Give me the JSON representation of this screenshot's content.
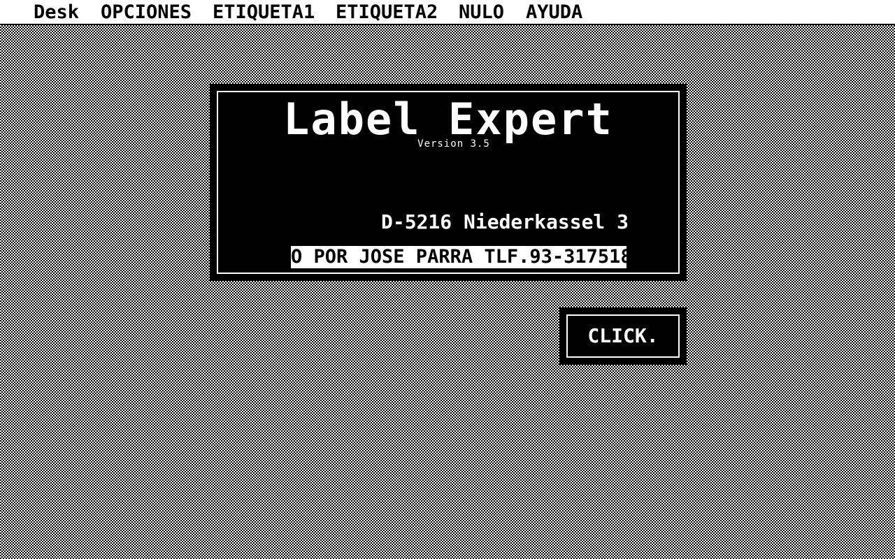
{
  "menubar": {
    "items": [
      {
        "label": "Desk"
      },
      {
        "label": "OPCIONES"
      },
      {
        "label": "ETIQUETA1"
      },
      {
        "label": "ETIQUETA2"
      },
      {
        "label": "NULO"
      },
      {
        "label": "AYUDA"
      }
    ]
  },
  "dialog": {
    "title": "Label Expert",
    "version": "Version 3.5",
    "address": "D-5216 Niederkassel 3",
    "credits": "O POR JOSE PARRA TLF.93-317518"
  },
  "button": {
    "label": "CLICK."
  },
  "colors": {
    "foreground": "#000000",
    "background": "#ffffff"
  }
}
